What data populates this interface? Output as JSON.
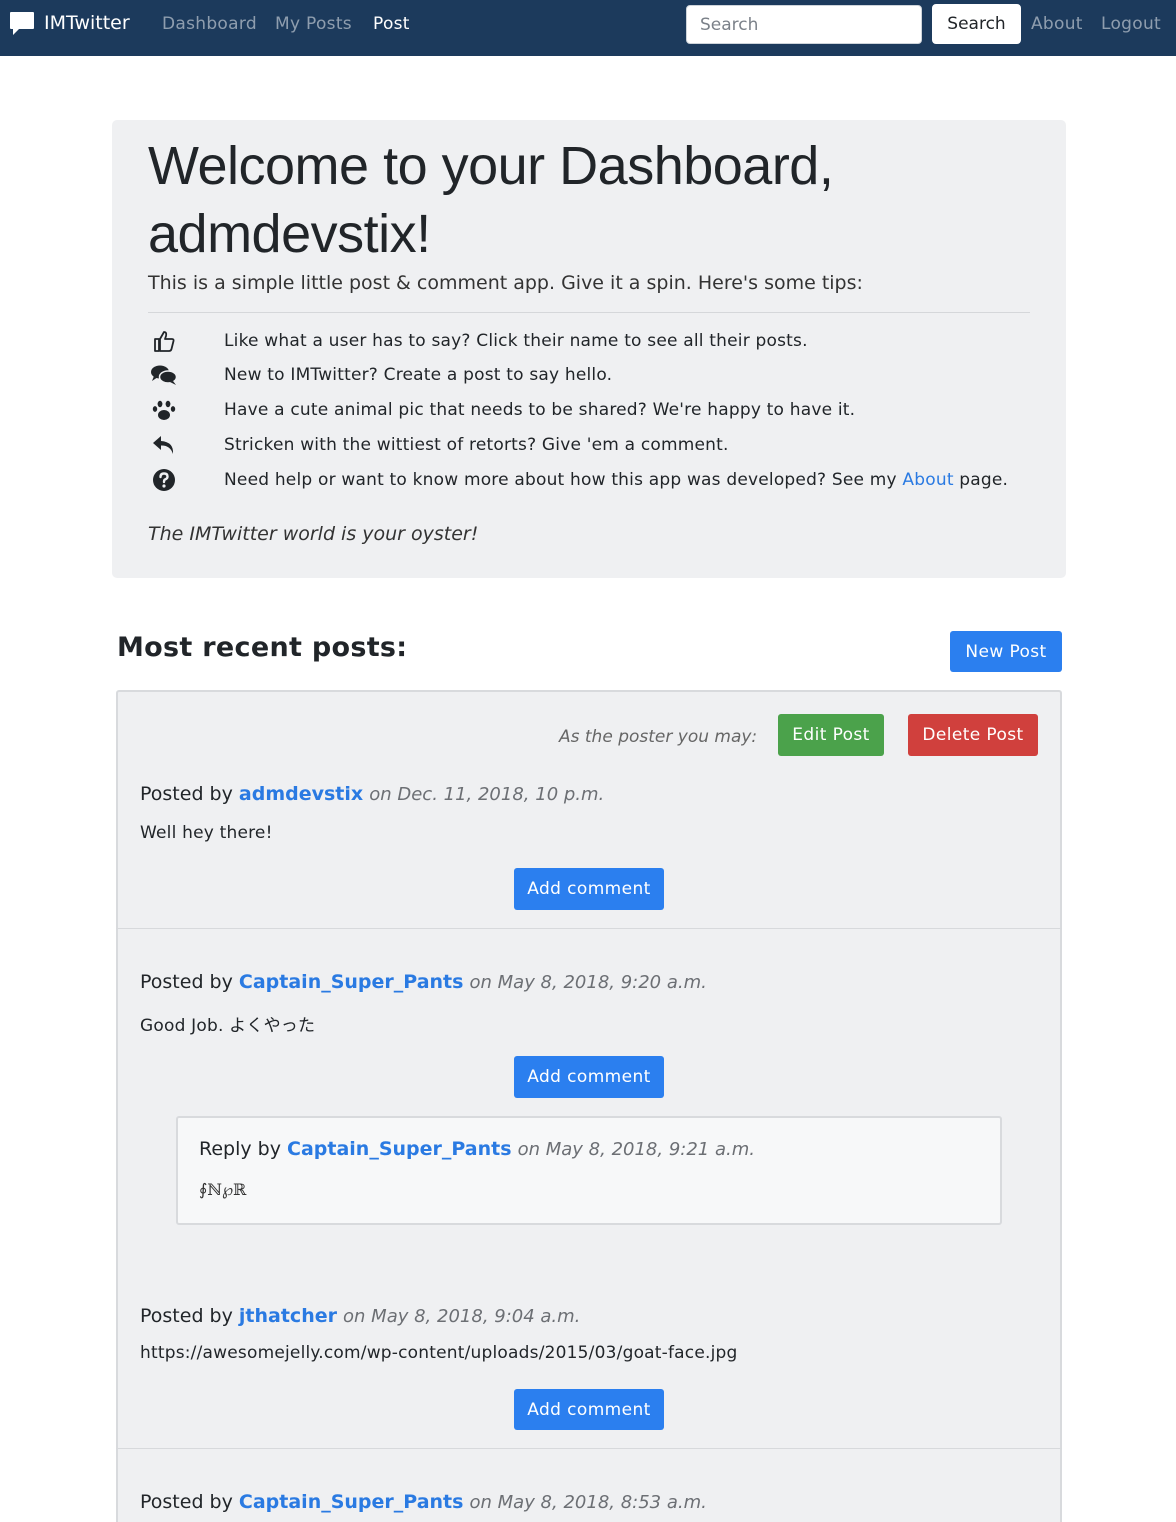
{
  "navbar": {
    "brand": "IMTwitter",
    "brand_icon": "speech-bubble-icon",
    "links": [
      "Dashboard",
      "My Posts",
      "Post"
    ],
    "active_link": "Post",
    "search_placeholder": "Search",
    "search_button": "Search",
    "right_links": [
      "About",
      "Logout"
    ],
    "background": "#1c3a5c"
  },
  "jumbotron": {
    "title": "Welcome to your Dashboard, admdevstix!",
    "lead": "This is a simple little post & comment app. Give it a spin. Here's some tips:",
    "tips": [
      {
        "icon": "thumbs-up-icon",
        "text": "Like what a user has to say? Click their name to see all their posts."
      },
      {
        "icon": "comments-icon",
        "text": "New to IMTwitter? Create a post to say hello."
      },
      {
        "icon": "paw-icon",
        "text": "Have a cute animal pic that needs to be shared? We're happy to have it."
      },
      {
        "icon": "reply-icon",
        "text": "Stricken with the wittiest of retorts? Give 'em a comment."
      },
      {
        "icon": "question-circle-icon",
        "text_before": "Need help or want to know more about how this app was developed? See my ",
        "link": "About",
        "text_after": " page."
      }
    ],
    "tagline": "The IMTwitter world is your oyster!"
  },
  "recent": {
    "heading": "Most recent posts:",
    "new_post_button": "New Post",
    "poster_note": "As the poster you may:",
    "edit_button": "Edit Post",
    "delete_button": "Delete Post",
    "posts": [
      {
        "prefix": "Posted by",
        "user": "admdevstix",
        "date": "on Dec. 11, 2018, 10 p.m.",
        "body": "Well hey there!",
        "comment_button": "Add comment"
      },
      {
        "prefix": "Posted by",
        "user": "Captain_Super_Pants",
        "date": "on May 8, 2018, 9:20 a.m.",
        "body": "Good Job. よくやった",
        "comment_button": "Add comment",
        "reply": {
          "prefix": "Reply by",
          "user": "Captain_Super_Pants",
          "date": "on May 8, 2018, 9:21 a.m.",
          "body": "∮ℕ℘ℝ"
        }
      },
      {
        "prefix": "Posted by",
        "user": "jthatcher",
        "date": "on May 8, 2018, 9:04 a.m.",
        "body": "https://awesomejelly.com/wp-content/uploads/2015/03/goat-face.jpg",
        "comment_button": "Add comment"
      },
      {
        "prefix": "Posted by",
        "user": "Captain_Super_Pants",
        "date": "on May 8, 2018, 8:53 a.m."
      }
    ]
  },
  "colors": {
    "link": "#2a7ae2",
    "primary": "#2b7fef",
    "success": "#4ba24b",
    "danger": "#d0403d",
    "panel": "#eff0f2"
  }
}
